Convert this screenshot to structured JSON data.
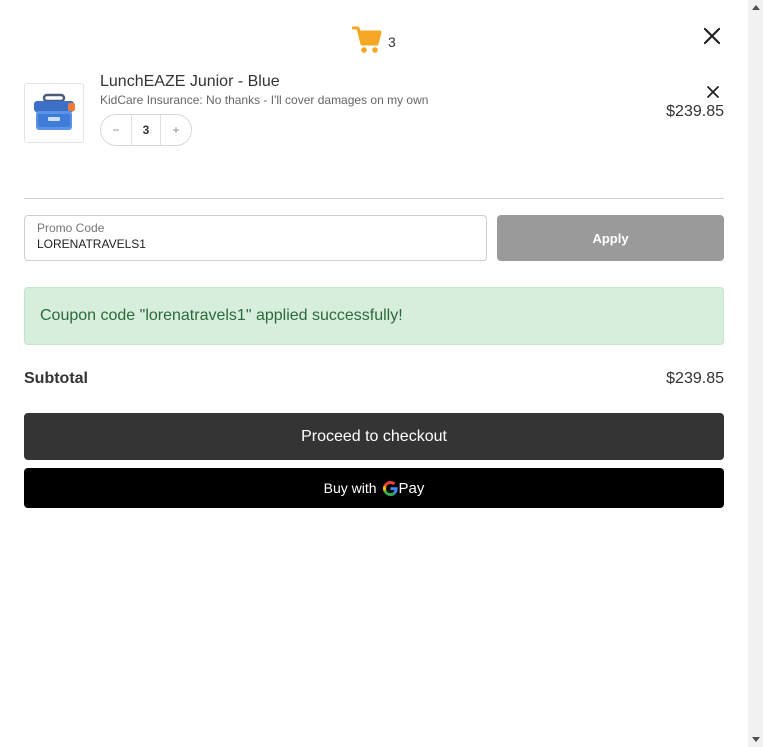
{
  "header": {
    "cart_count": "3",
    "close_label": "close cart"
  },
  "line_item": {
    "title": "LunchEAZE Junior - Blue",
    "variant": "KidCare Insurance: No thanks - I'll cover damages on my own",
    "quantity": "3",
    "decrement": "−",
    "increment": "+",
    "price": "$239.85"
  },
  "promo": {
    "label": "Promo Code",
    "value": "LORENATRAVELS1",
    "apply_label": "Apply"
  },
  "coupon_message": "Coupon code \"lorenatravels1\" applied successfully!",
  "subtotal": {
    "label": "Subtotal",
    "value": "$239.85"
  },
  "checkout_label": "Proceed to checkout",
  "gpay": {
    "prefix": "Buy with",
    "pay": "Pay"
  },
  "colors": {
    "cart_icon": "#f5a623",
    "apply_button": "#9a9a9a",
    "success_bg": "#d7eedc",
    "success_text": "#2b6a3a",
    "checkout_button": "#343434",
    "gpay_button": "#000000"
  },
  "icons": {
    "cart": "shopping-cart-icon",
    "close": "close-icon",
    "remove": "remove-item-icon",
    "google": "google-g-icon"
  }
}
